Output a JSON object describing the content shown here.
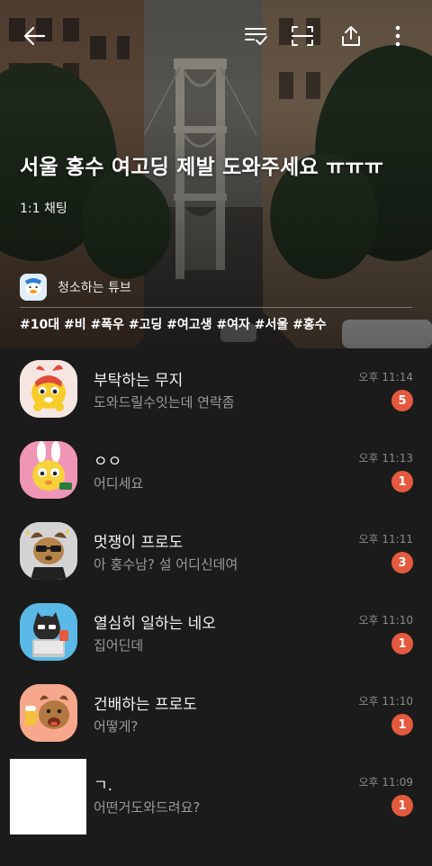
{
  "header": {
    "title": "서울 홍수 여고딩 제발 도와주세요 ㅠㅠㅠ",
    "chat_type": "1:1 채팅",
    "host_name": "청소하는 튜브",
    "tags": "#10대 #비 #폭우 #고딩 #여고생 #여자 #서울 #홍수"
  },
  "topbar": {
    "icons": [
      "back-arrow-icon",
      "sort-check-icon",
      "scan-frame-icon",
      "share-upload-icon",
      "more-vert-icon"
    ]
  },
  "colors": {
    "background": "#1b1b1b",
    "badge": "#e45a3f",
    "message_text": "#9a9a9a",
    "time_text": "#8a8a8a"
  },
  "chats": [
    {
      "name": "부탁하는 무지",
      "message": "도와드릴수잇는데 연락좀",
      "time": "오후 11:14",
      "unread": "5",
      "avatar": "muzi-pleading"
    },
    {
      "name": "ㅇㅇ",
      "message": "어디세요",
      "time": "오후 11:13",
      "unread": "1",
      "avatar": "muzi-pink"
    },
    {
      "name": "멋쟁이 프로도",
      "message": "아 홍수남? 설 어디신데여",
      "time": "오후 11:11",
      "unread": "3",
      "avatar": "frodo-cool"
    },
    {
      "name": "열심히 일하는 네오",
      "message": "집어딘데",
      "time": "오후 11:10",
      "unread": "1",
      "avatar": "neo-working"
    },
    {
      "name": "건배하는 프로도",
      "message": "어떻게?",
      "time": "오후 11:10",
      "unread": "1",
      "avatar": "frodo-cheers"
    },
    {
      "name": "ㄱ.",
      "message": "어떤거도와드려요?",
      "time": "오후 11:09",
      "unread": "1",
      "avatar": "blank"
    }
  ]
}
